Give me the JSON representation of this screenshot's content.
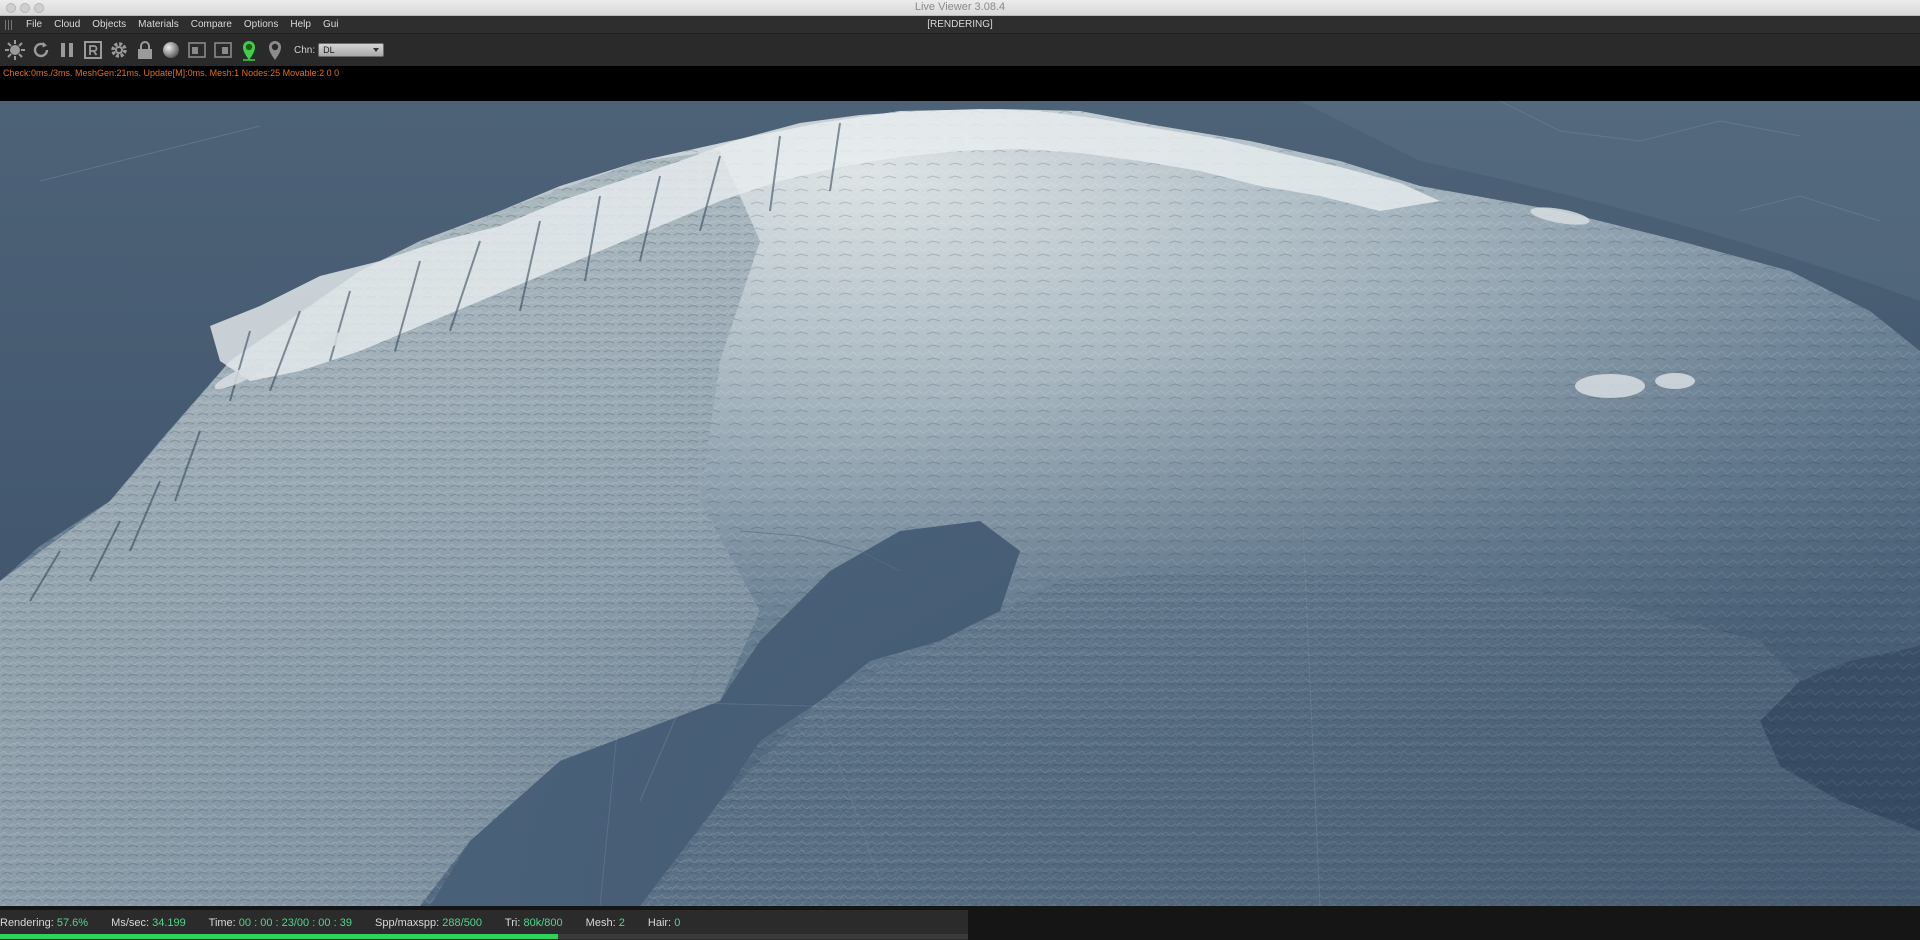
{
  "window": {
    "title": "Live Viewer 3.08.4",
    "traffic_lights": [
      "close",
      "minimize",
      "zoom"
    ]
  },
  "menubar": {
    "items": [
      "File",
      "Cloud",
      "Objects",
      "Materials",
      "Compare",
      "Options",
      "Help",
      "Gui"
    ],
    "render_state": "[RENDERING]"
  },
  "toolbar": {
    "buttons": [
      {
        "icon": "sun-icon"
      },
      {
        "icon": "restart-icon"
      },
      {
        "icon": "pause-icon"
      },
      {
        "icon": "region-render-icon"
      },
      {
        "icon": "gear-icon"
      },
      {
        "icon": "lock-icon"
      },
      {
        "icon": "material-sphere-icon"
      },
      {
        "icon": "viewport-left-icon"
      },
      {
        "icon": "viewport-right-icon"
      },
      {
        "icon": "focus-pin-icon"
      },
      {
        "icon": "white-balance-pin-icon"
      }
    ],
    "channel_label": "Chn:",
    "channel_value": "DL"
  },
  "stats": {
    "text": "Check:0ms./3ms. MeshGen:21ms. Update[M]:0ms. Mesh:1 Nodes:25 Movable:2  0 0"
  },
  "status": {
    "rendering_label": "Rendering:",
    "rendering_value": "57.6%",
    "ms_label": "Ms/sec:",
    "ms_value": "34.199",
    "time_label": "Time:",
    "time_value": "00 : 00 : 23/00 : 00 : 39",
    "spp_label": "Spp/maxspp:",
    "spp_value": "288/500",
    "tri_label": "Tri:",
    "tri_value": "80k/800",
    "mesh_label": "Mesh:",
    "mesh_value": "2",
    "hair_label": "Hair:",
    "hair_value": "0",
    "progress_fraction": 0.576
  },
  "colors": {
    "stats_text": "#e0701c",
    "status_value": "#4fd68a",
    "progress": "#2fd25f",
    "land_lit": "#c9d2d6",
    "sea": "#3f5670"
  }
}
